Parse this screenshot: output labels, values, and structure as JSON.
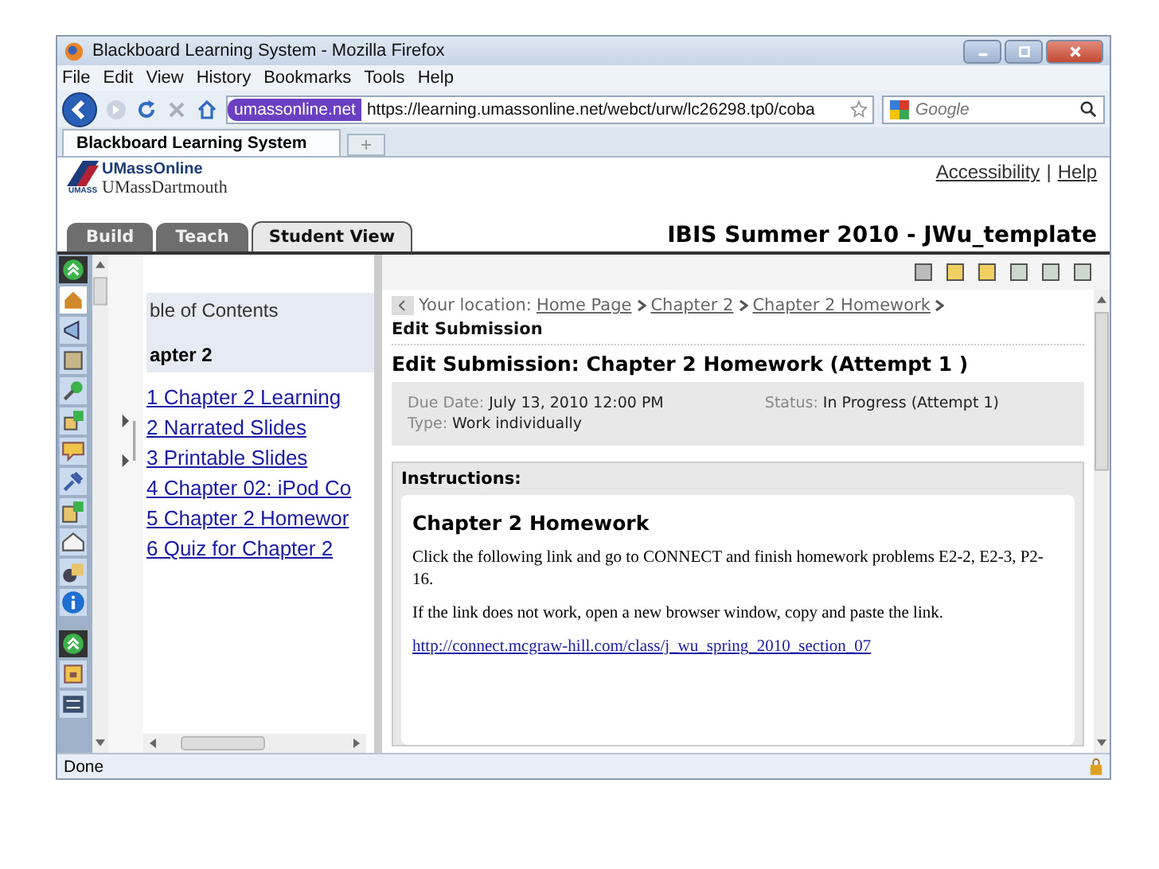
{
  "window": {
    "title": "Blackboard Learning System - Mozilla Firefox"
  },
  "menu": [
    "File",
    "Edit",
    "View",
    "History",
    "Bookmarks",
    "Tools",
    "Help"
  ],
  "address_bar": {
    "site_badge": "umassonline.net",
    "url": "https://learning.umassonline.net/webct/urw/lc26298.tp0/coba"
  },
  "search": {
    "placeholder": "Google"
  },
  "browser_tabs": [
    {
      "label": "Blackboard Learning System",
      "selected": true
    }
  ],
  "header": {
    "logo_mark": "UMASS",
    "logo_line_1": "UMassOnline",
    "logo_line_2": "UMassDartmouth",
    "links": [
      "Accessibility",
      "Help"
    ],
    "separator": "|"
  },
  "course_tabs": [
    {
      "label": "Build",
      "selected": false
    },
    {
      "label": "Teach",
      "selected": false
    },
    {
      "label": "Student View",
      "selected": true
    }
  ],
  "course_title": "IBIS Summer 2010 - JWu_template",
  "toc": {
    "title": "ble of Contents",
    "section": "apter 2",
    "items": [
      "1 Chapter 2 Learning",
      "2 Narrated Slides",
      "3 Printable Slides",
      "4 Chapter 02: iPod Co",
      "5 Chapter 2 Homewor",
      "6 Quiz for Chapter 2"
    ]
  },
  "breadcrumb": {
    "label": "Your location:",
    "links": [
      "Home Page",
      "Chapter 2",
      "Chapter 2 Homework"
    ],
    "current": "Edit Submission"
  },
  "heading": "Edit Submission: Chapter 2 Homework (Attempt 1 )",
  "details": [
    {
      "label": "Due Date:",
      "value": "July 13, 2010 12:00 PM"
    },
    {
      "label": "Status:",
      "value": "In Progress (Attempt 1)"
    },
    {
      "label": "Type:",
      "value": "Work individually"
    }
  ],
  "instructions": {
    "label": "Instructions:",
    "title": "Chapter 2 Homework",
    "paragraphs": [
      "Click the following link and go to CONNECT and finish homework problems E2-2, E2-3, P2-16.",
      "If the  link does not work, open a new browser window, copy and paste the link."
    ],
    "link": "http://connect.mcgraw-hill.com/class/j_wu_spring_2010_section_07"
  },
  "status_bar": "Done"
}
